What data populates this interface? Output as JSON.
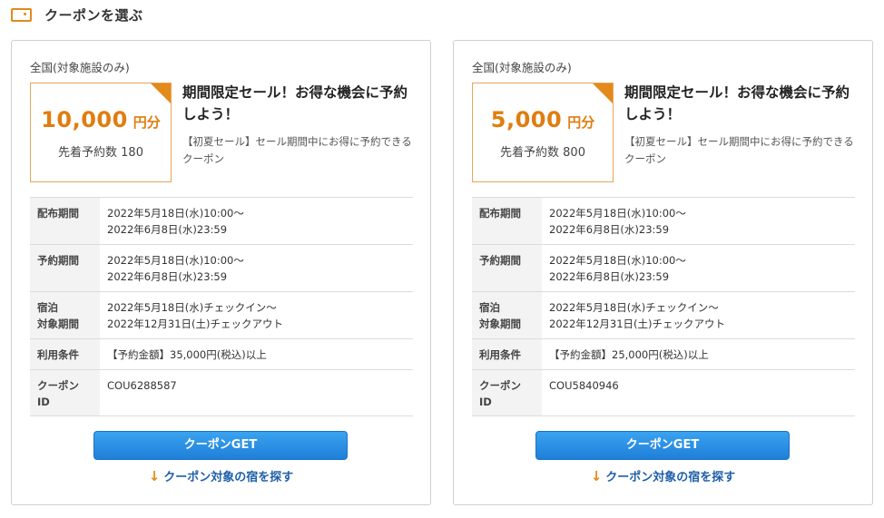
{
  "section": {
    "title": "クーポンを選ぶ",
    "icon": "ticket-icon",
    "accent": "#e08a1e"
  },
  "coupons": [
    {
      "scope": "全国(対象施設のみ)",
      "amount": "10,000",
      "unit": "円分",
      "first_come": "先着予約数 180",
      "headline": "期間限定セール！お得な機会に予約しよう！",
      "description": "【初夏セール】セール期間中にお得に予約できるクーポン",
      "details": [
        {
          "label": "配布期間",
          "lines": [
            "2022年5月18日(水)10:00～",
            "2022年6月8日(水)23:59"
          ]
        },
        {
          "label": "予約期間",
          "lines": [
            "2022年5月18日(水)10:00～",
            "2022年6月8日(水)23:59"
          ]
        },
        {
          "label": "宿泊\n対象期間",
          "lines": [
            "2022年5月18日(水)チェックイン～",
            "2022年12月31日(土)チェックアウト"
          ]
        },
        {
          "label": "利用条件",
          "lines": [
            "【予約金額】35,000円(税込)以上"
          ]
        },
        {
          "label": "クーポン\nID",
          "lines": [
            "COU6288587"
          ]
        }
      ],
      "button": "クーポンGET",
      "link": "クーポン対象の宿を探す"
    },
    {
      "scope": "全国(対象施設のみ)",
      "amount": "5,000",
      "unit": "円分",
      "first_come": "先着予約数 800",
      "headline": "期間限定セール！お得な機会に予約しよう！",
      "description": "【初夏セール】セール期間中にお得に予約できるクーポン",
      "details": [
        {
          "label": "配布期間",
          "lines": [
            "2022年5月18日(水)10:00～",
            "2022年6月8日(水)23:59"
          ]
        },
        {
          "label": "予約期間",
          "lines": [
            "2022年5月18日(水)10:00～",
            "2022年6月8日(水)23:59"
          ]
        },
        {
          "label": "宿泊\n対象期間",
          "lines": [
            "2022年5月18日(水)チェックイン～",
            "2022年12月31日(土)チェックアウト"
          ]
        },
        {
          "label": "利用条件",
          "lines": [
            "【予約金額】25,000円(税込)以上"
          ]
        },
        {
          "label": "クーポン\nID",
          "lines": [
            "COU5840946"
          ]
        }
      ],
      "button": "クーポンGET",
      "link": "クーポン対象の宿を探す"
    }
  ],
  "colors": {
    "amount": "#e07d10",
    "button": "#2a8fe4",
    "link": "#1d5fa8",
    "arrow": "#e8891a"
  }
}
